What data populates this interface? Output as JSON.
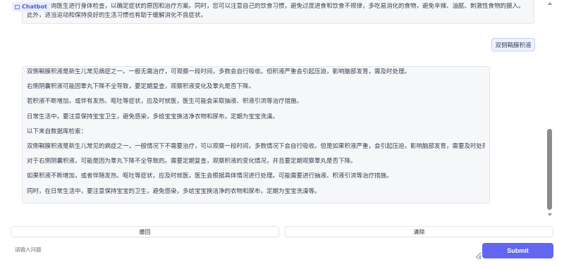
{
  "chatbot_label": "Chatbot",
  "messages": {
    "bot_top_lines": [
      "建议您咨询医生进行身体检查，以确定症状的原因和治疗方案。同时，您可以注意自己的饮食习惯，避免过度进食和饮食不规律，多吃易消化的食物，避免辛辣、油腻、刺激性食物的摄入。",
      "此外，适当运动和保持良好的生活习惯也有助于缓解消化不良症状。"
    ],
    "user": "双侧鞘膜积液",
    "bot_main_lines": [
      "双侧鞘膜积液是新生儿常见病症之一。一般无需治疗，可观察一段时间，多数会自行吸收。但积液严重会引起压迫，影响脑部发育，需及时处理。",
      "右侧阴囊积液可能因睾丸下降不全导致，要定期复查，观察积液变化及睾丸是否下降。",
      "若积液不断增加，或伴有发热、呕吐等症状，应及时就医，医生可能会采取抽液、积液引流等治疗措施。",
      "日常生活中，要注意保持宝宝卫生，避免感染，多给宝宝换洁净衣物和尿布，定期为宝宝洗澡。",
      "以下来自数据库检索：",
      "双侧鞘膜积液是新生儿常见的病症之一，一般情况下不需要治疗，可以观察一段时间，多数情况下会自行吸收。但是如果积液严重，会引起压迫，影响脑部发育，需要及时处理。",
      "对于右侧阴囊积液，可能是因为睾丸下降不全导致的。需要定期复查，观察积液的变化情况，并且要定期观察睾丸是否下降。",
      "如果积液不断增加，或者伴随发热、呕吐等症状，应及时就医，医生会根据具体情况进行处理。可能需要进行抽液、积液引流等治疗措施。",
      "同时，在日常生活中，要注意保持宝宝的卫生，避免感染，多给宝宝换洁净的衣物和尿布，定期为宝宝洗澡等。"
    ]
  },
  "buttons": {
    "undo": "撤回",
    "clear": "清除",
    "submit": "Submit"
  },
  "input": {
    "placeholder": "请输入问题",
    "value": ""
  },
  "colors": {
    "accent": "#6366f1",
    "chatbot_label_bg": "#e8edff",
    "user_bubble_bg": "#eef2ff",
    "bot_bubble_bg": "#f6f7f9"
  }
}
